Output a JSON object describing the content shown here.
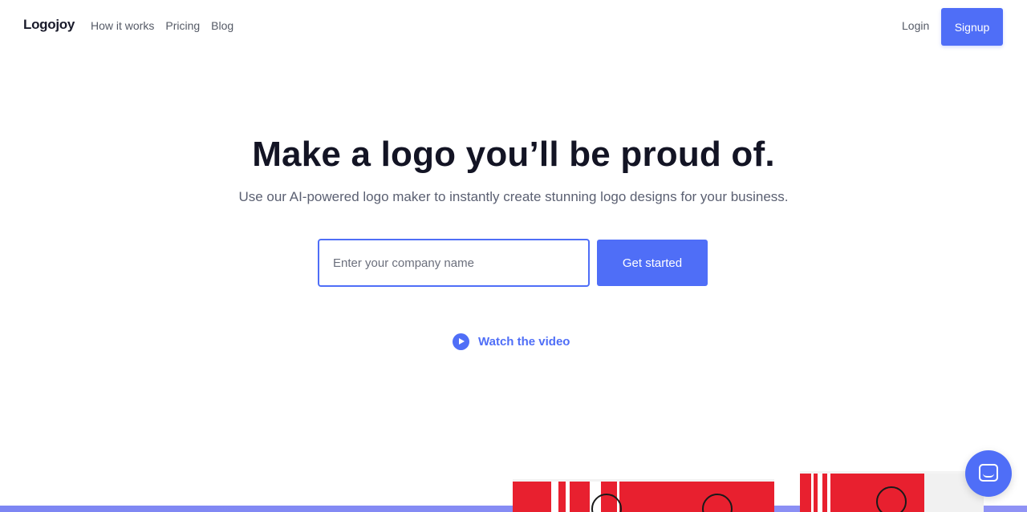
{
  "header": {
    "logo": "Logojoy",
    "nav": [
      "How it works",
      "Pricing",
      "Blog"
    ],
    "login": "Login",
    "signup": "Signup"
  },
  "hero": {
    "title": "Make a logo you’ll be proud of.",
    "subtitle": "Use our AI-powered logo maker to instantly create stunning logo designs for your business.",
    "input_placeholder": "Enter your company name",
    "input_value": "",
    "cta": "Get started",
    "video_link": "Watch the video"
  },
  "icons": {
    "play": "play-icon",
    "chat": "chat-icon"
  },
  "colors": {
    "accent": "#4f6ef7",
    "heading": "#131424",
    "bag_red": "#e8202f"
  }
}
